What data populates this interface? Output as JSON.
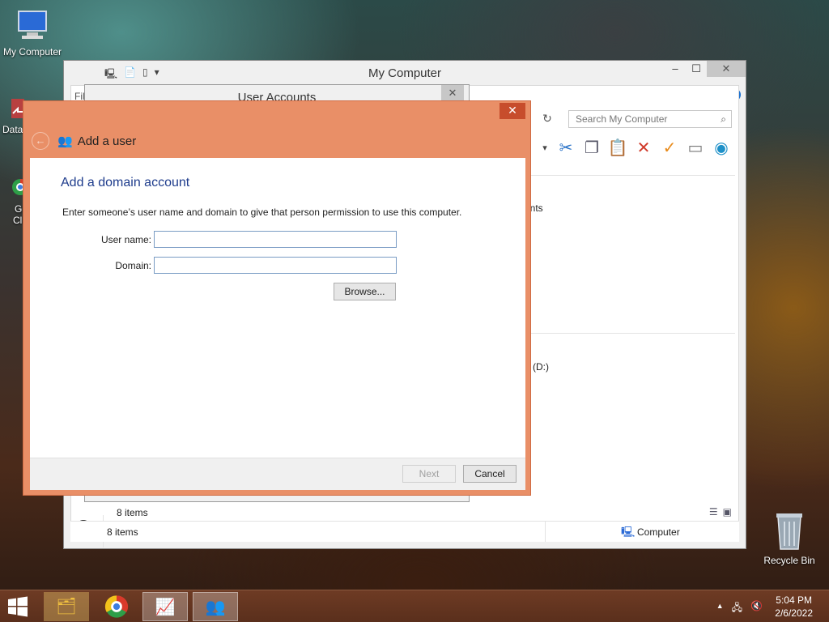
{
  "desktop": {
    "icons": [
      {
        "label": "My Computer"
      },
      {
        "label": "Data"
      },
      {
        "label": "G"
      },
      {
        "label": "Cl"
      },
      {
        "label": "Recycle Bin"
      }
    ]
  },
  "my_computer_window": {
    "title": "My Computer",
    "menu_fragment": "Fil",
    "search_placeholder": "Search My Computer",
    "status_items": "8 items",
    "status_items_inner": "8 items",
    "status_location": "Computer",
    "partial_text_1": "ents",
    "partial_text_2": "e (D:)"
  },
  "user_accounts_window": {
    "title": "User Accounts"
  },
  "add_user_dialog": {
    "header_title": "Add a user",
    "heading": "Add a domain account",
    "description": "Enter someone’s user name and domain to give that person permission to use this computer.",
    "username_label": "User name:",
    "username_value": "",
    "domain_label": "Domain:",
    "domain_value": "",
    "browse_label": "Browse...",
    "next_label": "Next",
    "cancel_label": "Cancel"
  },
  "taskbar": {
    "time": "5:04 PM",
    "date": "2/6/2022"
  },
  "colors": {
    "dialog_accent": "#e98f67",
    "heading_blue": "#1e3c8c"
  }
}
